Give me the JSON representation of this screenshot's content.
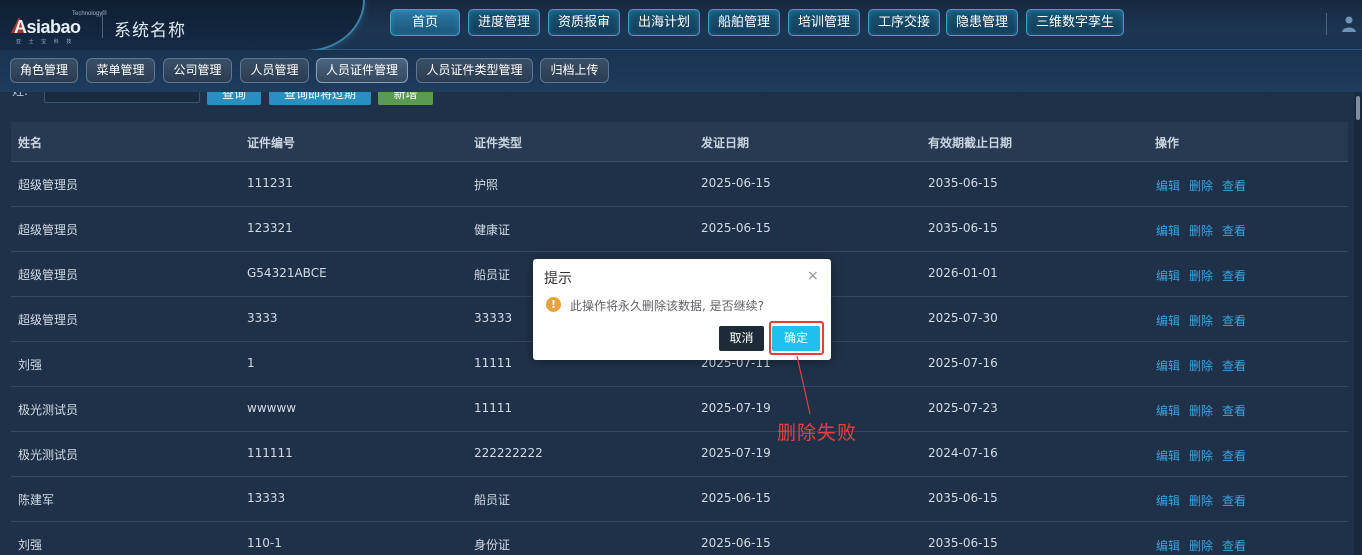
{
  "brand": {
    "logo_small": "Technology®",
    "logo_main": "Asiabao",
    "logo_sub": "亚 士 宝 科 技",
    "app_title": "系统名称"
  },
  "nav": [
    {
      "label": "首页"
    },
    {
      "label": "进度管理"
    },
    {
      "label": "资质报审"
    },
    {
      "label": "出海计划"
    },
    {
      "label": "船舶管理"
    },
    {
      "label": "培训管理"
    },
    {
      "label": "工序交接"
    },
    {
      "label": "隐患管理"
    },
    {
      "label": "三维数字孪生"
    }
  ],
  "subtabs": [
    {
      "label": "角色管理"
    },
    {
      "label": "菜单管理"
    },
    {
      "label": "公司管理"
    },
    {
      "label": "人员管理"
    },
    {
      "label": "人员证件管理",
      "active": true
    },
    {
      "label": "人员证件类型管理"
    },
    {
      "label": "归档上传"
    }
  ],
  "filter": {
    "label": "姓:",
    "query": "查询",
    "expiring": "查询即将过期",
    "add": "新增"
  },
  "table": {
    "headers": [
      "姓名",
      "证件编号",
      "证件类型",
      "发证日期",
      "有效期截止日期",
      "操作"
    ],
    "actions": [
      "编辑",
      "删除",
      "查看"
    ],
    "rows": [
      [
        "超级管理员",
        "111231",
        "护照",
        "2025-06-15",
        "2035-06-15"
      ],
      [
        "超级管理员",
        "123321",
        "健康证",
        "2025-06-15",
        "2035-06-15"
      ],
      [
        "超级管理员",
        "G54321ABCE",
        "船员证",
        "",
        "2026-01-01"
      ],
      [
        "超级管理员",
        "3333",
        "33333",
        "",
        "2025-07-30"
      ],
      [
        "刘强",
        "1",
        "11111",
        "2025-07-11",
        "2025-07-16"
      ],
      [
        "极光测试员",
        "wwwww",
        "11111",
        "2025-07-19",
        "2025-07-23"
      ],
      [
        "极光测试员",
        "111111",
        "222222222",
        "2025-07-19",
        "2024-07-16"
      ],
      [
        "陈建军",
        "13333",
        "船员证",
        "2025-06-15",
        "2035-06-15"
      ],
      [
        "刘强",
        "110-1",
        "身份证",
        "2025-06-15",
        "2035-06-15"
      ]
    ]
  },
  "dialog": {
    "title": "提示",
    "close": "×",
    "icon": "!",
    "message": "此操作将永久删除该数据, 是否继续?",
    "cancel": "取消",
    "confirm": "确定"
  },
  "annotation": {
    "text": "删除失败",
    "color": "#e8403d"
  },
  "colors": {
    "link": "#3aa3e0",
    "confirm": "#1ec0f0",
    "warning": "#e6a23c"
  }
}
